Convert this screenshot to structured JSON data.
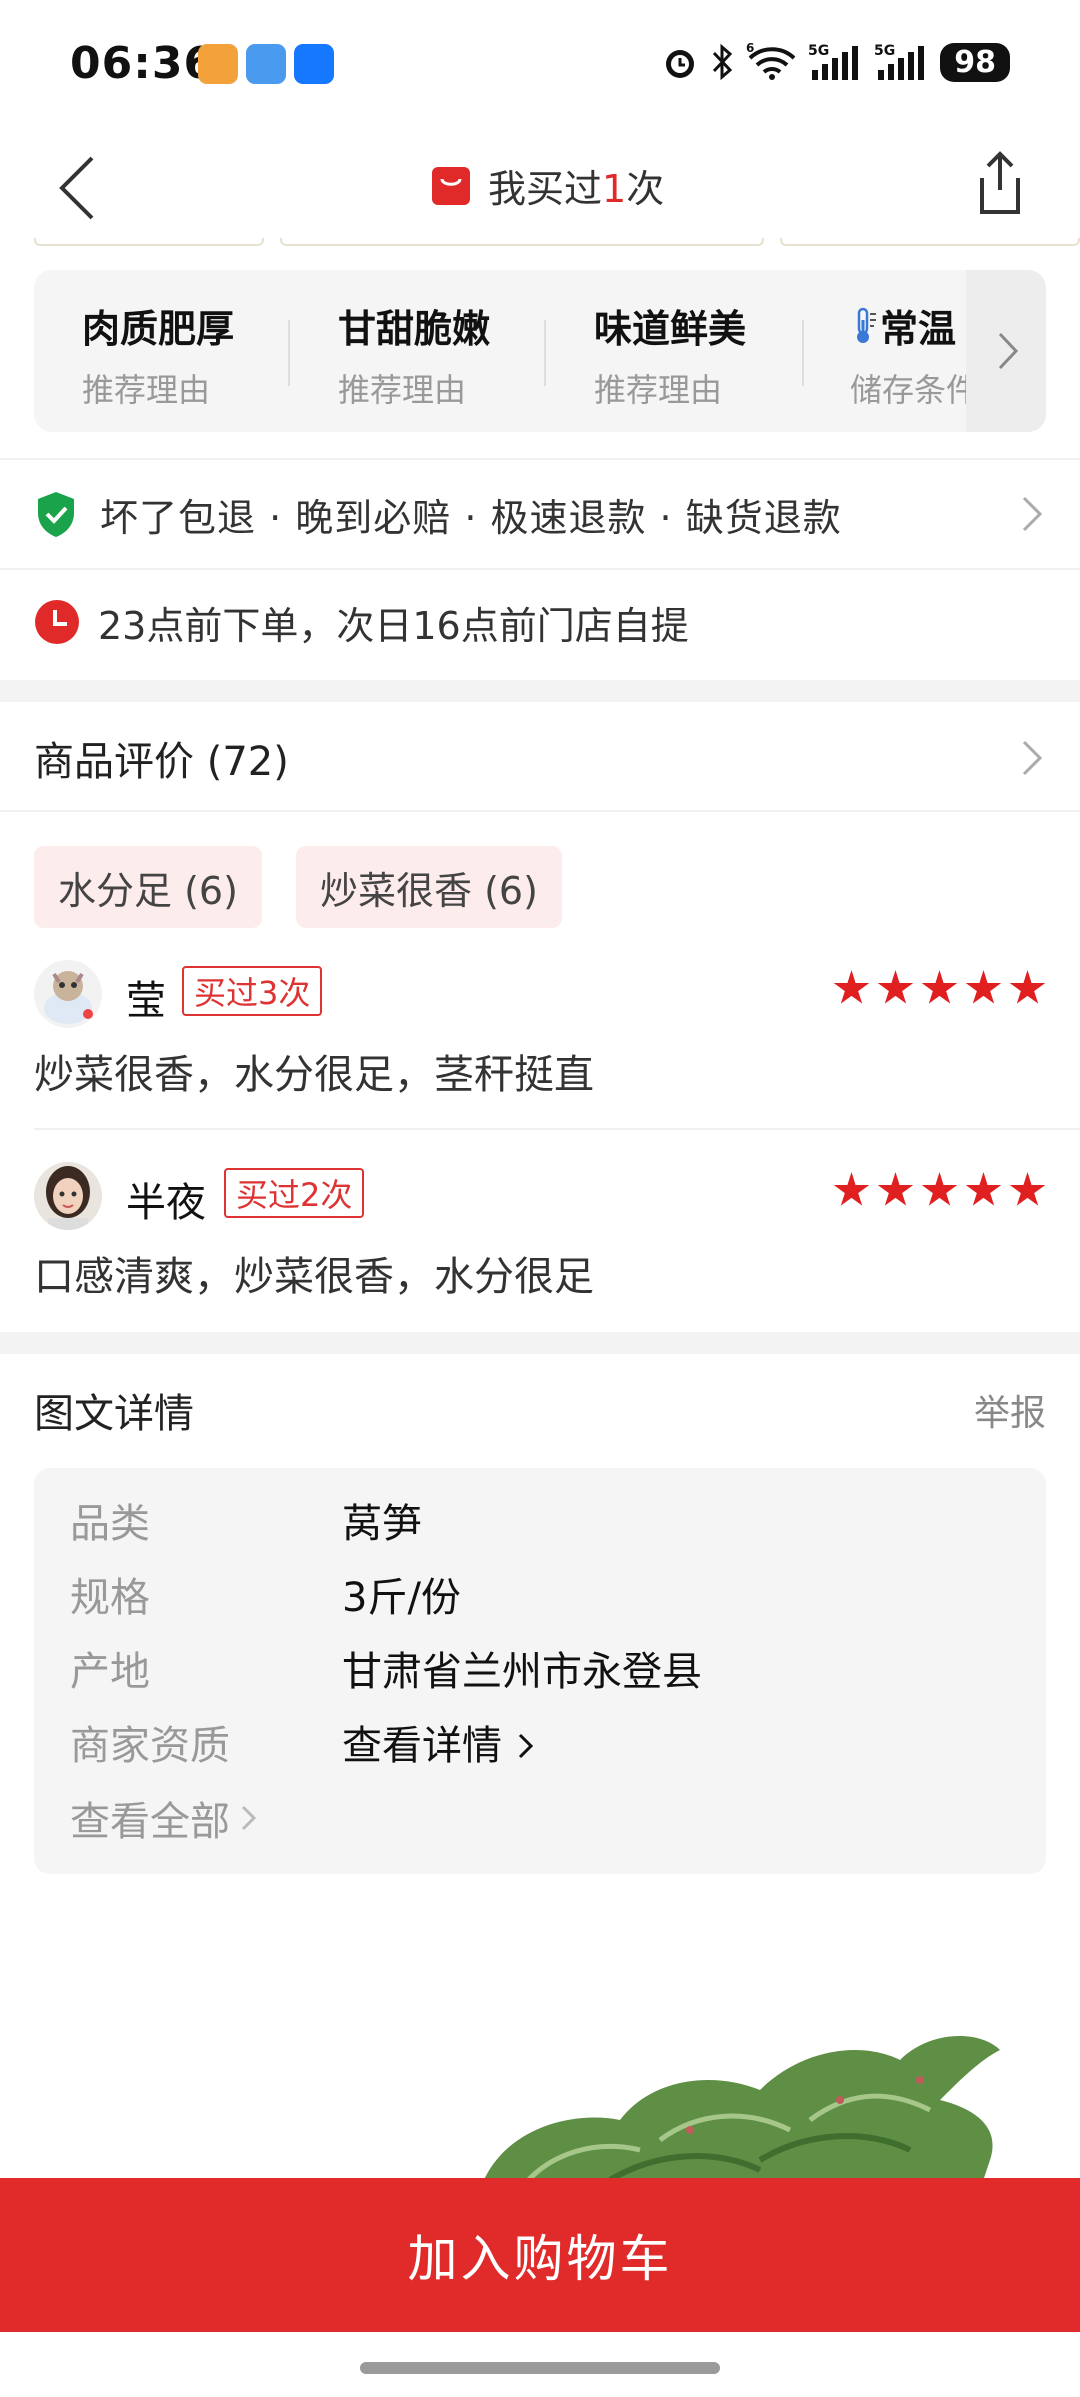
{
  "status_bar": {
    "time": "06:36",
    "battery": "98",
    "network_1": "5G",
    "network_2": "5G",
    "wifi_label": "6"
  },
  "nav": {
    "title_prefix": "我买过",
    "title_count": "1",
    "title_suffix": "次",
    "accent_color": "#e02a2a"
  },
  "reasons": [
    {
      "title": "肉质肥厚",
      "sub": "推荐理由"
    },
    {
      "title": "甘甜脆嫩",
      "sub": "推荐理由"
    },
    {
      "title": "味道鲜美",
      "sub": "推荐理由"
    },
    {
      "title": "常温",
      "sub": "储存条件",
      "icon": "thermometer-icon"
    }
  ],
  "guarantee": {
    "text": "坏了包退 · 晚到必赔 · 极速退款 · 缺货退款",
    "icon": "shield-check-icon"
  },
  "delivery": {
    "text": "23点前下单，次日16点前门店自提",
    "icon": "clock-icon"
  },
  "reviews": {
    "title": "商品评价 (72)",
    "tags": [
      "水分足 (6)",
      "炒菜很香 (6)"
    ],
    "items": [
      {
        "name": "莹",
        "badge": "买过3次",
        "rating": 5,
        "text": "炒菜很香，水分很足，茎秆挺直"
      },
      {
        "name": "半夜",
        "badge": "买过2次",
        "rating": 5,
        "text": "口感清爽，炒菜很香，水分很足"
      }
    ]
  },
  "details": {
    "title": "图文详情",
    "report": "举报",
    "specs": [
      {
        "key": "品类",
        "value": "莴笋"
      },
      {
        "key": "规格",
        "value": "3斤/份"
      },
      {
        "key": "产地",
        "value": "甘肃省兰州市永登县"
      },
      {
        "key": "商家资质",
        "value": "查看详情"
      }
    ],
    "view_all": "查看全部"
  },
  "cart": {
    "label": "加入购物车",
    "color": "#e12b2b"
  }
}
